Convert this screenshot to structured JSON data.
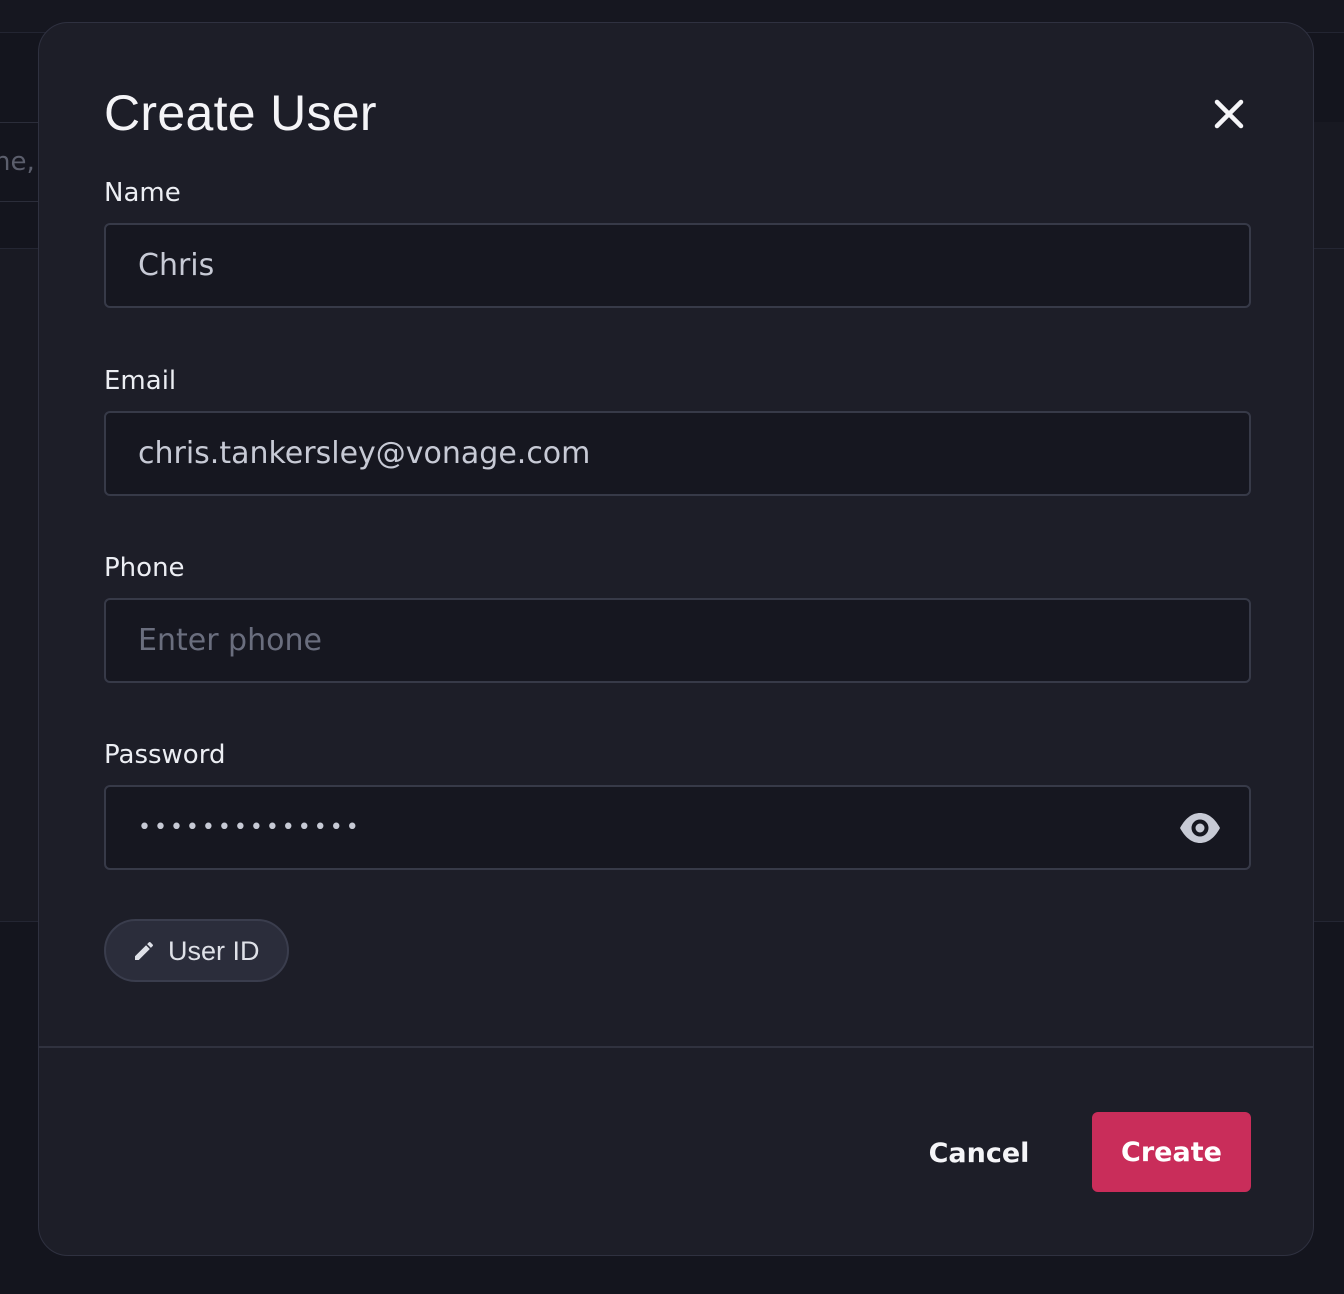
{
  "background": {
    "search_fragment": "ne,"
  },
  "modal": {
    "title": "Create User",
    "close_icon": "close-icon",
    "fields": {
      "name": {
        "label": "Name",
        "value": "Chris",
        "placeholder": ""
      },
      "email": {
        "label": "Email",
        "value": "chris.tankersley@vonage.com",
        "placeholder": ""
      },
      "phone": {
        "label": "Phone",
        "value": "",
        "placeholder": "Enter phone"
      },
      "password": {
        "label": "Password",
        "masked_value": "••••••••••••••",
        "visibility_icon": "eye-icon"
      }
    },
    "user_id_button": {
      "label": "User ID",
      "icon": "pencil-icon"
    },
    "footer": {
      "cancel_label": "Cancel",
      "create_label": "Create"
    }
  },
  "colors": {
    "accent": "#c92d5a",
    "modal_bg": "#1d1e28",
    "input_bg": "#161720",
    "page_bg": "#14151e"
  }
}
